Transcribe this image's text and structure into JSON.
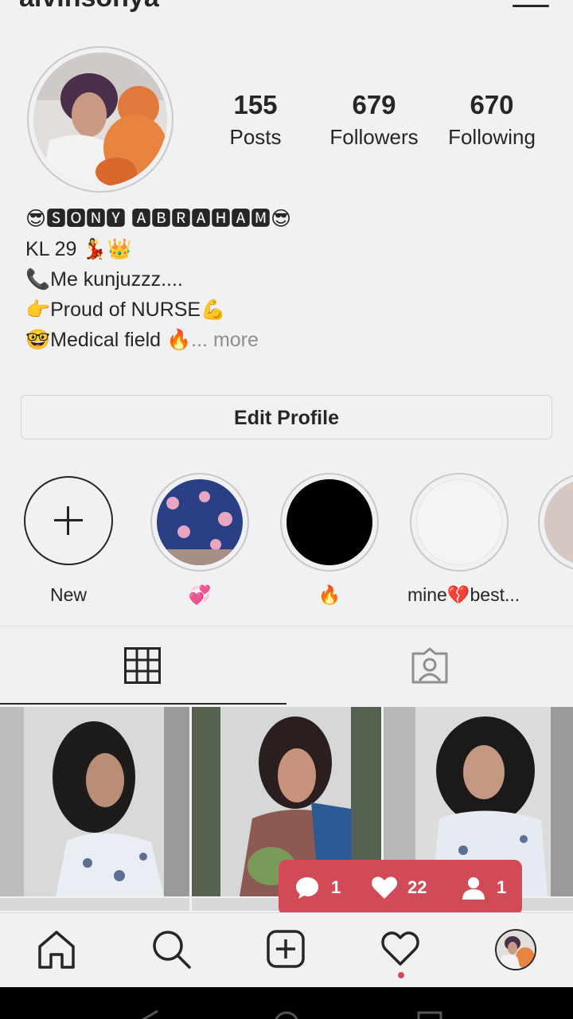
{
  "profile": {
    "username": "alvinsonya",
    "stats": {
      "posts_count": "155",
      "posts_label": "Posts",
      "followers_count": "679",
      "followers_label": "Followers",
      "following_count": "670",
      "following_label": "Following"
    },
    "bio": {
      "name_line": "😎🆂🅾🅽🆈 🅰🅱🆁🅰🅷🅰🅼😎",
      "line2": "KL 29 💃👑",
      "line3": "📞Me kunjuzzz....",
      "line4": "👉Proud of NURSE💪",
      "line5": "🤓Medical field 🔥",
      "more": "... more"
    },
    "edit_button_label": "Edit Profile"
  },
  "highlights": [
    {
      "label": "New"
    },
    {
      "label": "💞"
    },
    {
      "label": "🔥"
    },
    {
      "label": "mine💔best..."
    }
  ],
  "notification": {
    "comments": "1",
    "likes": "22",
    "follows": "1"
  },
  "icons": {
    "menu": "menu-icon",
    "grid": "grid-icon",
    "tagged": "tagged-photos-icon",
    "home": "home-icon",
    "search": "search-icon",
    "add": "add-post-icon",
    "activity": "heart-icon",
    "comment": "comment-icon",
    "person": "person-icon"
  },
  "colors": {
    "notification_badge": "#d04a58",
    "text": "#262626",
    "muted": "#8e8e8e"
  }
}
